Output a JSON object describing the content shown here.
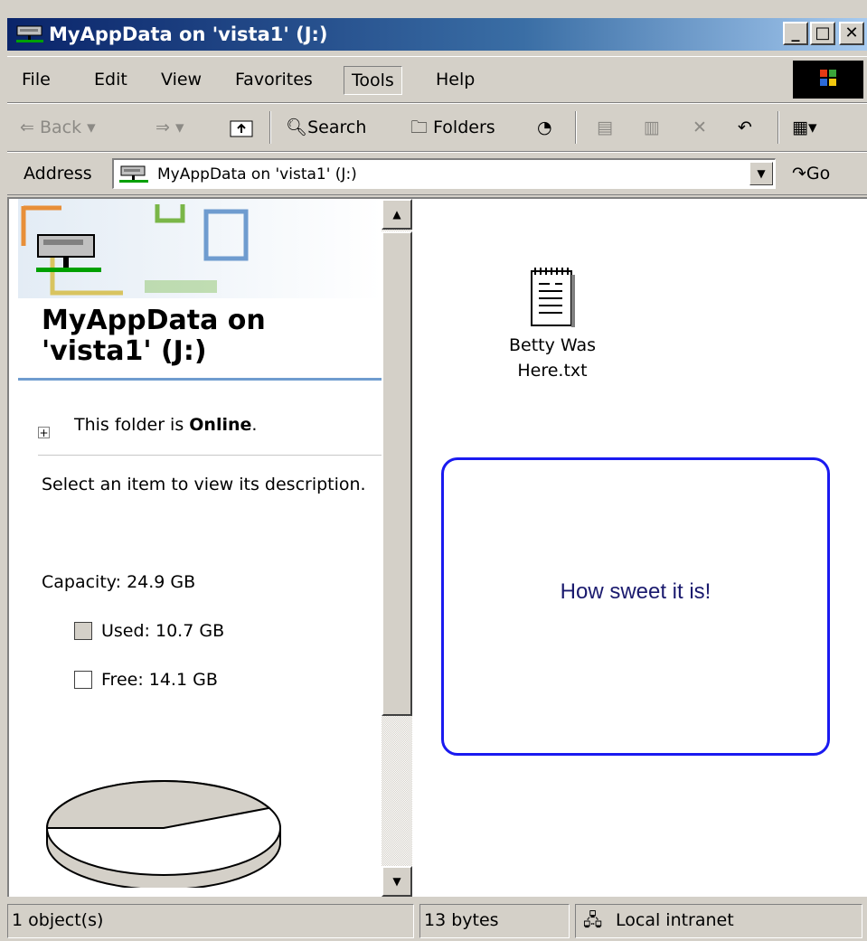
{
  "window": {
    "title": "MyAppData on 'vista1' (J:)",
    "minimize": "_",
    "maximize": "□",
    "close": "✕"
  },
  "menu": {
    "items": [
      "File",
      "Edit",
      "View",
      "Favorites",
      "Tools",
      "Help"
    ],
    "active": "Tools"
  },
  "toolbar": {
    "back": "Back",
    "search": "Search",
    "folders": "Folders"
  },
  "address": {
    "label": "Address",
    "value": "MyAppData on 'vista1' (J:)",
    "go": "Go"
  },
  "left_pane": {
    "title": "MyAppData on 'vista1' (J:)",
    "online_prefix": "This folder is ",
    "online_status": "Online",
    "online_suffix": ".",
    "description": "Select an item to view its description.",
    "capacity": "Capacity: 24.9 GB",
    "used": "Used: 10.7 GB",
    "free": "Free: 14.1 GB",
    "used_fraction": 0.43
  },
  "files": [
    {
      "name": "Betty Was Here.txt",
      "icon": "text-file-icon"
    }
  ],
  "note": {
    "text": "How sweet it is!",
    "border_color": "#1a1af0"
  },
  "status": {
    "objects": "1 object(s)",
    "size": "13 bytes",
    "zone": "Local intranet"
  },
  "colors": {
    "title_gradient_start": "#0a246a",
    "chrome": "#d4d0c8"
  }
}
